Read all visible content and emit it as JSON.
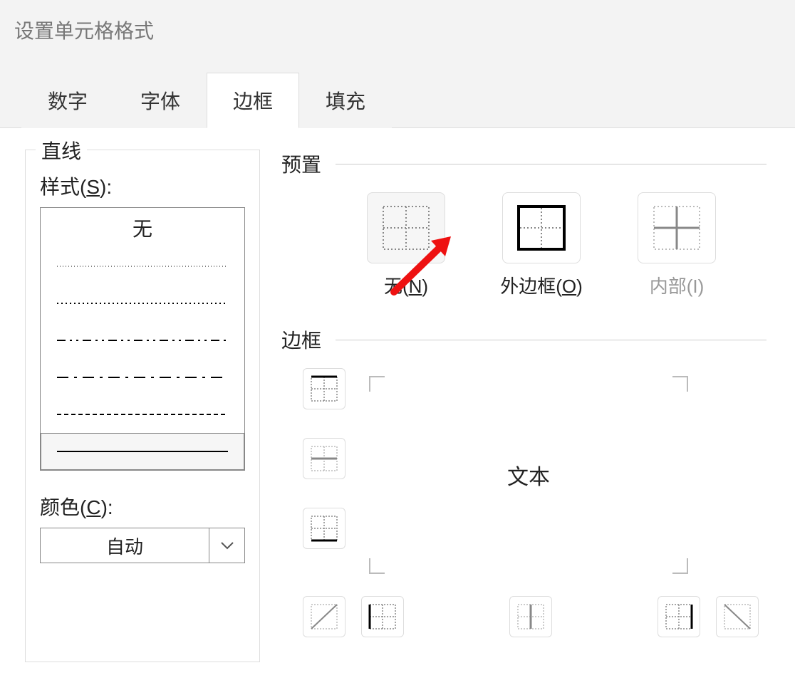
{
  "dialog": {
    "title": "设置单元格格式"
  },
  "tabs": [
    {
      "label": "数字"
    },
    {
      "label": "字体"
    },
    {
      "label": "边框",
      "active": true
    },
    {
      "label": "填充"
    }
  ],
  "line": {
    "section": "直线",
    "style_label": "样式(S):",
    "none_label": "无",
    "color_label": "颜色(C):",
    "color_value": "自动"
  },
  "presets": {
    "section": "预置",
    "none": "无(N)",
    "outline": "外边框(O)",
    "inside": "内部(I)"
  },
  "border": {
    "section": "边框",
    "preview_text": "文本"
  }
}
